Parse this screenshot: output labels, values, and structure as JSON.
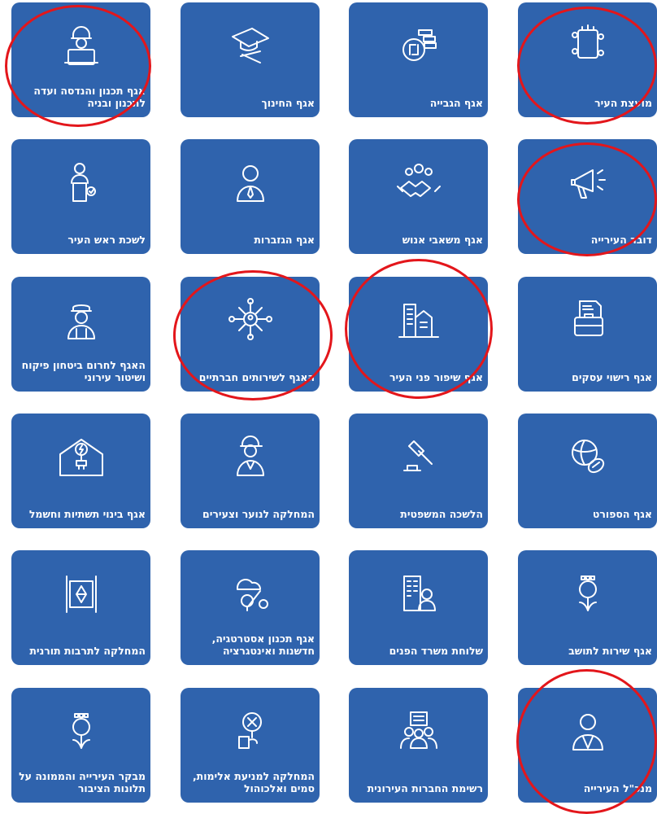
{
  "accent_color": "#2f63ad",
  "highlight_color": "#e3161b",
  "tiles": [
    {
      "label": "מועצת העיר",
      "icon": "city-council-icon"
    },
    {
      "label": "אגף הגבייה",
      "icon": "shekel-coins-icon"
    },
    {
      "label": "אגף החינוך",
      "icon": "graduation-cap-icon"
    },
    {
      "label": "אגף תכנון והנדסה ועדה\nלתכנון ובניה",
      "icon": "engineer-blueprint-icon"
    },
    {
      "label": "דובר העירייה",
      "icon": "megaphone-icon"
    },
    {
      "label": "אגף משאבי אנוש",
      "icon": "handshake-people-icon"
    },
    {
      "label": "אגף הגזברות",
      "icon": "treasurer-person-icon"
    },
    {
      "label": "לשכת ראש העיר",
      "icon": "mayor-podium-icon"
    },
    {
      "label": "אגף רישוי עסקים",
      "icon": "briefcase-document-icon"
    },
    {
      "label": "אגף שיפור פני העיר",
      "icon": "city-buildings-icon"
    },
    {
      "label": "האגף לשירותים חברתיים",
      "icon": "social-network-icon"
    },
    {
      "label": "האגף לחרום ביטחון פיקוח\nושיטור עירוני",
      "icon": "police-officer-icon"
    },
    {
      "label": "אגף הספורט",
      "icon": "sports-balls-icon"
    },
    {
      "label": "הלשכה המשפטית",
      "icon": "gavel-icon"
    },
    {
      "label": "המחלקה לנוער וצעירים",
      "icon": "youth-person-icon"
    },
    {
      "label": "אגף בינוי תשתיות וחשמל",
      "icon": "house-electric-icon"
    },
    {
      "label": "אגף שירות לתושב",
      "icon": "city-emblem-icon"
    },
    {
      "label": "שלוחת משרד הפנים",
      "icon": "office-building-person-icon"
    },
    {
      "label": "אגף תכנון אסטרטגיה,\nחדשנות ואינטגרציה",
      "icon": "strategy-innovation-icon"
    },
    {
      "label": "המחלקה לתרבות תורנית",
      "icon": "torah-scroll-icon"
    },
    {
      "label": "מנכ\"ל העירייה",
      "icon": "ceo-person-icon"
    },
    {
      "label": "רשימת החברות העירונית",
      "icon": "group-list-icon"
    },
    {
      "label": "המחלקה למניעת אלימות,\nסמים ואלכוהול",
      "icon": "prevention-magnifier-icon"
    },
    {
      "label": "מבקר העירייה והממונה על\nתלונות הציבור",
      "icon": "comptroller-emblem-icon"
    }
  ]
}
